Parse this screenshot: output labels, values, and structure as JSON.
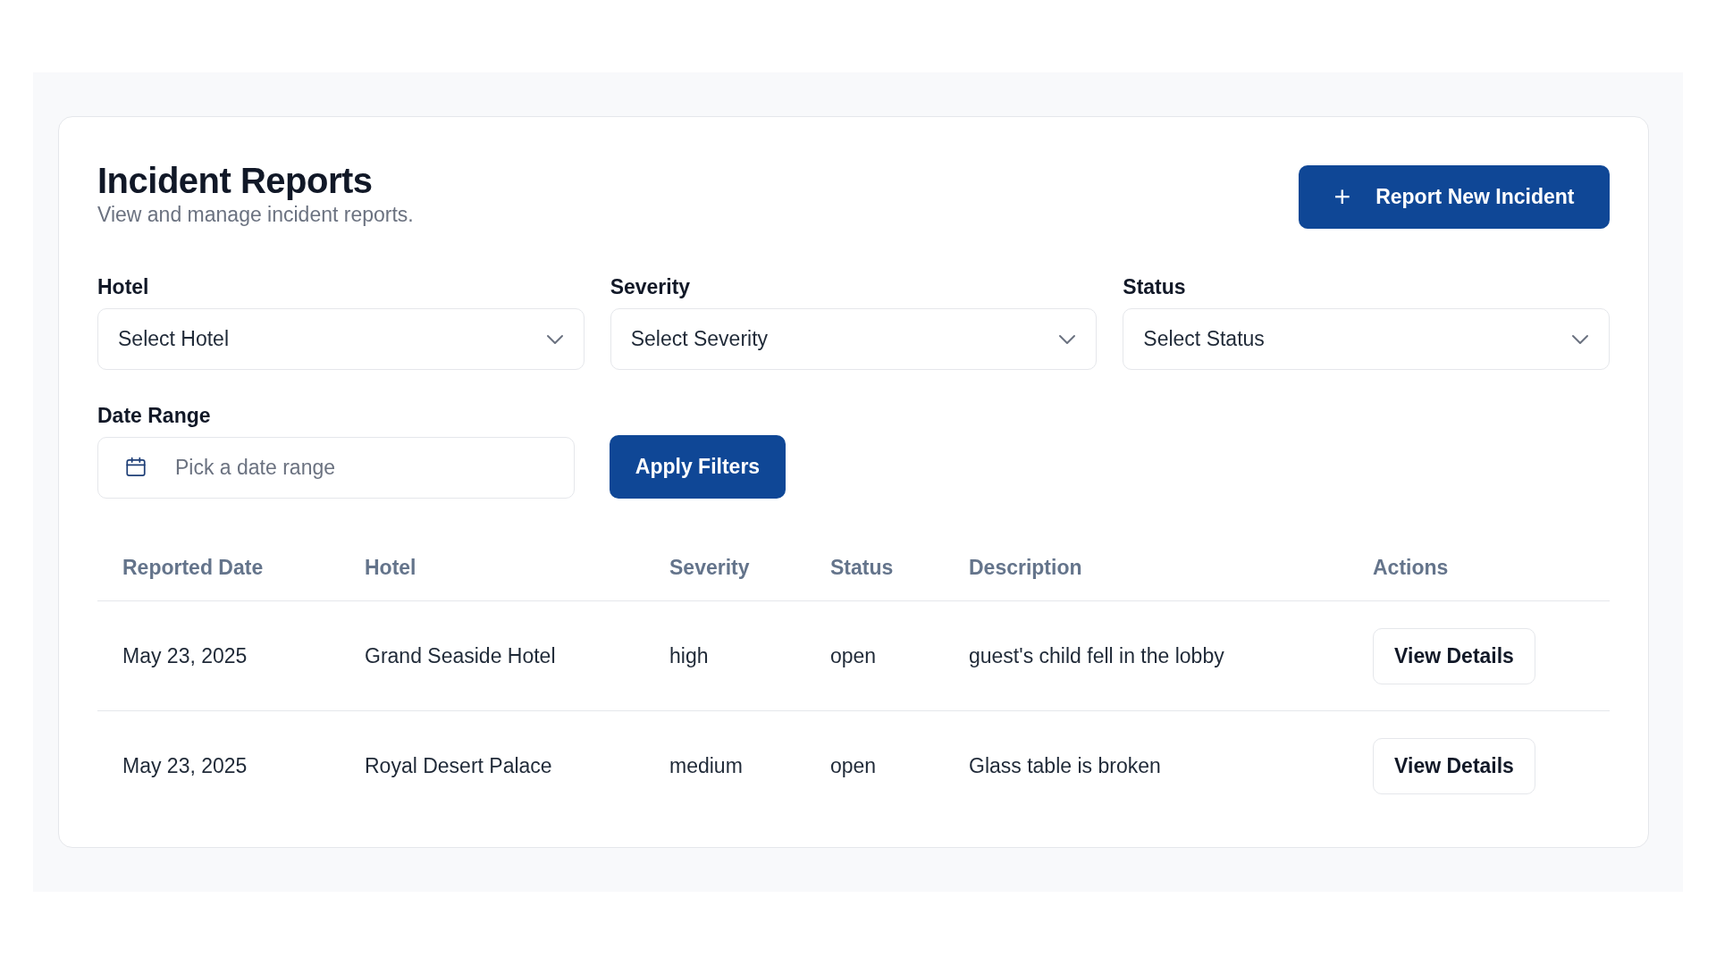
{
  "header": {
    "title": "Incident Reports",
    "subtitle": "View and manage incident reports.",
    "action_button": {
      "icon": "+",
      "label": "Report New Incident"
    }
  },
  "filters": [
    {
      "kind": "select",
      "label": "Hotel",
      "placeholder": "Select Hotel"
    },
    {
      "kind": "select",
      "label": "Severity",
      "placeholder": "Select Severity"
    },
    {
      "kind": "select",
      "label": "Status",
      "placeholder": "Select Status"
    },
    {
      "kind": "date",
      "label": "Date Range",
      "placeholder": "Pick a date range"
    }
  ],
  "apply_button": "Apply Filters",
  "table": {
    "columns": [
      "Reported Date",
      "Hotel",
      "Severity",
      "Status",
      "Description",
      "Actions"
    ],
    "rows": [
      {
        "reported_date": "May 23, 2025",
        "hotel": "Grand Seaside Hotel",
        "severity": "high",
        "status": "open",
        "description": "guest's child fell in the lobby",
        "action": "View Details"
      },
      {
        "reported_date": "May 23, 2025",
        "hotel": "Royal Desert Palace",
        "severity": "medium",
        "status": "open",
        "description": "Glass table is broken",
        "action": "View Details"
      }
    ]
  }
}
